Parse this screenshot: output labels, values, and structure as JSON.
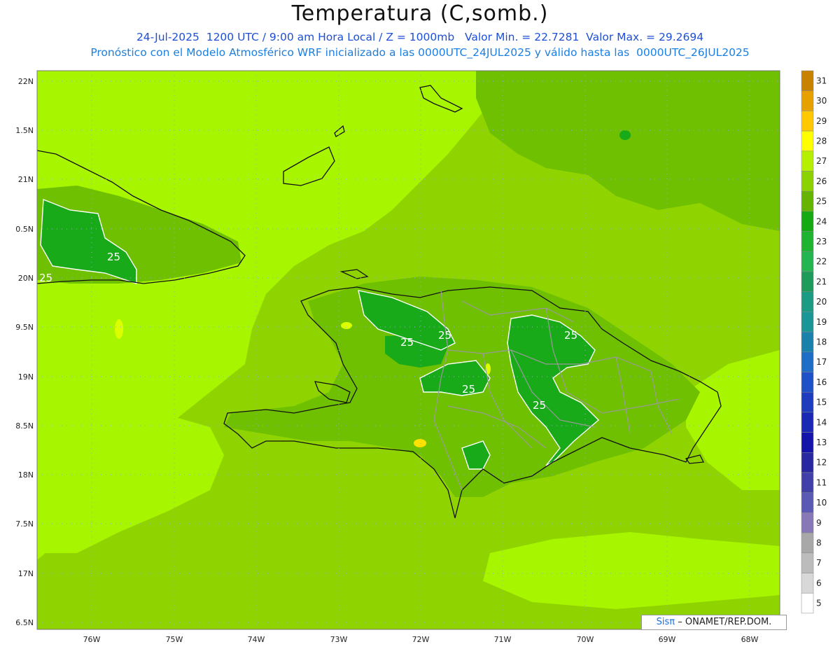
{
  "header": {
    "title": "Temperatura (C,somb.)",
    "line1": "24-Jul-2025  1200 UTC / 9:00 am Hora Local / Z = 1000mb   Valor Min. = 22.7281  Valor Max. = 29.2694",
    "line2": "Pronóstico con el Modelo Atmosférico WRF inicializado a las 0000UTC_24JUL2025 y válido hasta las  0000UTC_26JUL2025"
  },
  "map": {
    "lat_labels": [
      "22N",
      "1.5N",
      "21N",
      "0.5N",
      "20N",
      "9.5N",
      "19N",
      "8.5N",
      "18N",
      "7.5N",
      "17N",
      "6.5N"
    ],
    "lon_labels": [
      "76W",
      "75W",
      "74W",
      "73W",
      "72W",
      "71W",
      "70W",
      "69W",
      "68W"
    ],
    "contour_labels": [
      "25",
      "25",
      "25",
      "25",
      "25",
      "25",
      "25",
      "25"
    ],
    "fill_colors": {
      "c26": "#8fd400",
      "c27": "#a8f500",
      "c25": "#6fc000",
      "c24": "#19aa19",
      "c28": "#dcff00",
      "c29": "#ffe100"
    }
  },
  "colorbar": {
    "levels": [
      "31",
      "30",
      "29",
      "28",
      "27",
      "26",
      "25",
      "24",
      "23",
      "22",
      "21",
      "20",
      "19",
      "18",
      "17",
      "16",
      "15",
      "14",
      "13",
      "12",
      "11",
      "10",
      "9",
      "8",
      "7",
      "6",
      "5"
    ],
    "colors": [
      "#c88200",
      "#e6a000",
      "#ffc800",
      "#ffff00",
      "#b4f000",
      "#8cd200",
      "#64b400",
      "#14aa14",
      "#1eb432",
      "#24b450",
      "#1e9b5a",
      "#1a9b82",
      "#1a9696",
      "#1a82aa",
      "#1e6ec8",
      "#1e50c8",
      "#1e3cbe",
      "#1a28b4",
      "#1414aa",
      "#2828a0",
      "#4040a8",
      "#5a5ab4",
      "#8878b8",
      "#a8a8a8",
      "#bcbcbc",
      "#d8d8d8",
      "#ffffff"
    ]
  },
  "credit": {
    "brand": "Sisπ",
    "text": "– ONAMET/REP.DOM."
  }
}
